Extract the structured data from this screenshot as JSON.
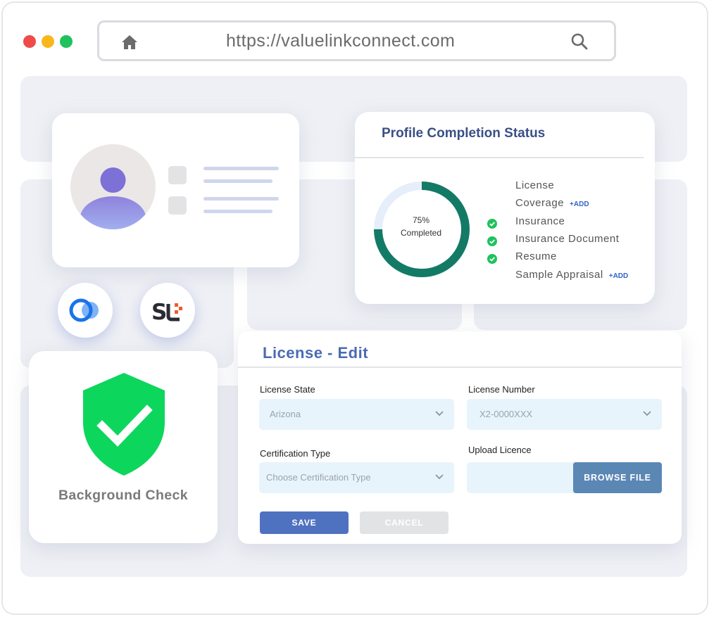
{
  "browser": {
    "url": "https://valuelinkconnect.com",
    "dots": [
      "#f04a4a",
      "#f8b71c",
      "#1fc25c"
    ],
    "home_icon": "home-icon",
    "search_icon": "search-icon"
  },
  "profile_status": {
    "title": "Profile Completion Status",
    "percent": 75,
    "percent_label": "75%",
    "completed_label": "Completed",
    "items": [
      {
        "label": "License",
        "checked": false,
        "add": ""
      },
      {
        "label": "Coverage",
        "checked": false,
        "add": "+ADD"
      },
      {
        "label": "Insurance",
        "checked": true,
        "add": ""
      },
      {
        "label": "Insurance Document",
        "checked": true,
        "add": ""
      },
      {
        "label": "Resume",
        "checked": true,
        "add": ""
      },
      {
        "label": "Sample Appraisal",
        "checked": false,
        "add": "+ADD"
      }
    ],
    "colors": {
      "ring": "#137a66",
      "track": "#e6eefc",
      "check": "#1fc25c"
    }
  },
  "license_edit": {
    "title": "License - Edit",
    "license_state": {
      "label": "License State",
      "value": "Arizona"
    },
    "license_number": {
      "label": "License Number",
      "value": "X2-0000XXX"
    },
    "certification_type": {
      "label": "Certification Type",
      "placeholder": "Choose Certification Type"
    },
    "upload": {
      "label": "Upload Licence",
      "button": "BROWSE FILE"
    },
    "save_label": "SAVE",
    "cancel_label": "CANCEL"
  },
  "background_check": {
    "label": "Background Check",
    "icon": "shield-check-icon",
    "color": "#0dd65d"
  },
  "logos": [
    "overlapping-circles-logo",
    "st-logo"
  ]
}
